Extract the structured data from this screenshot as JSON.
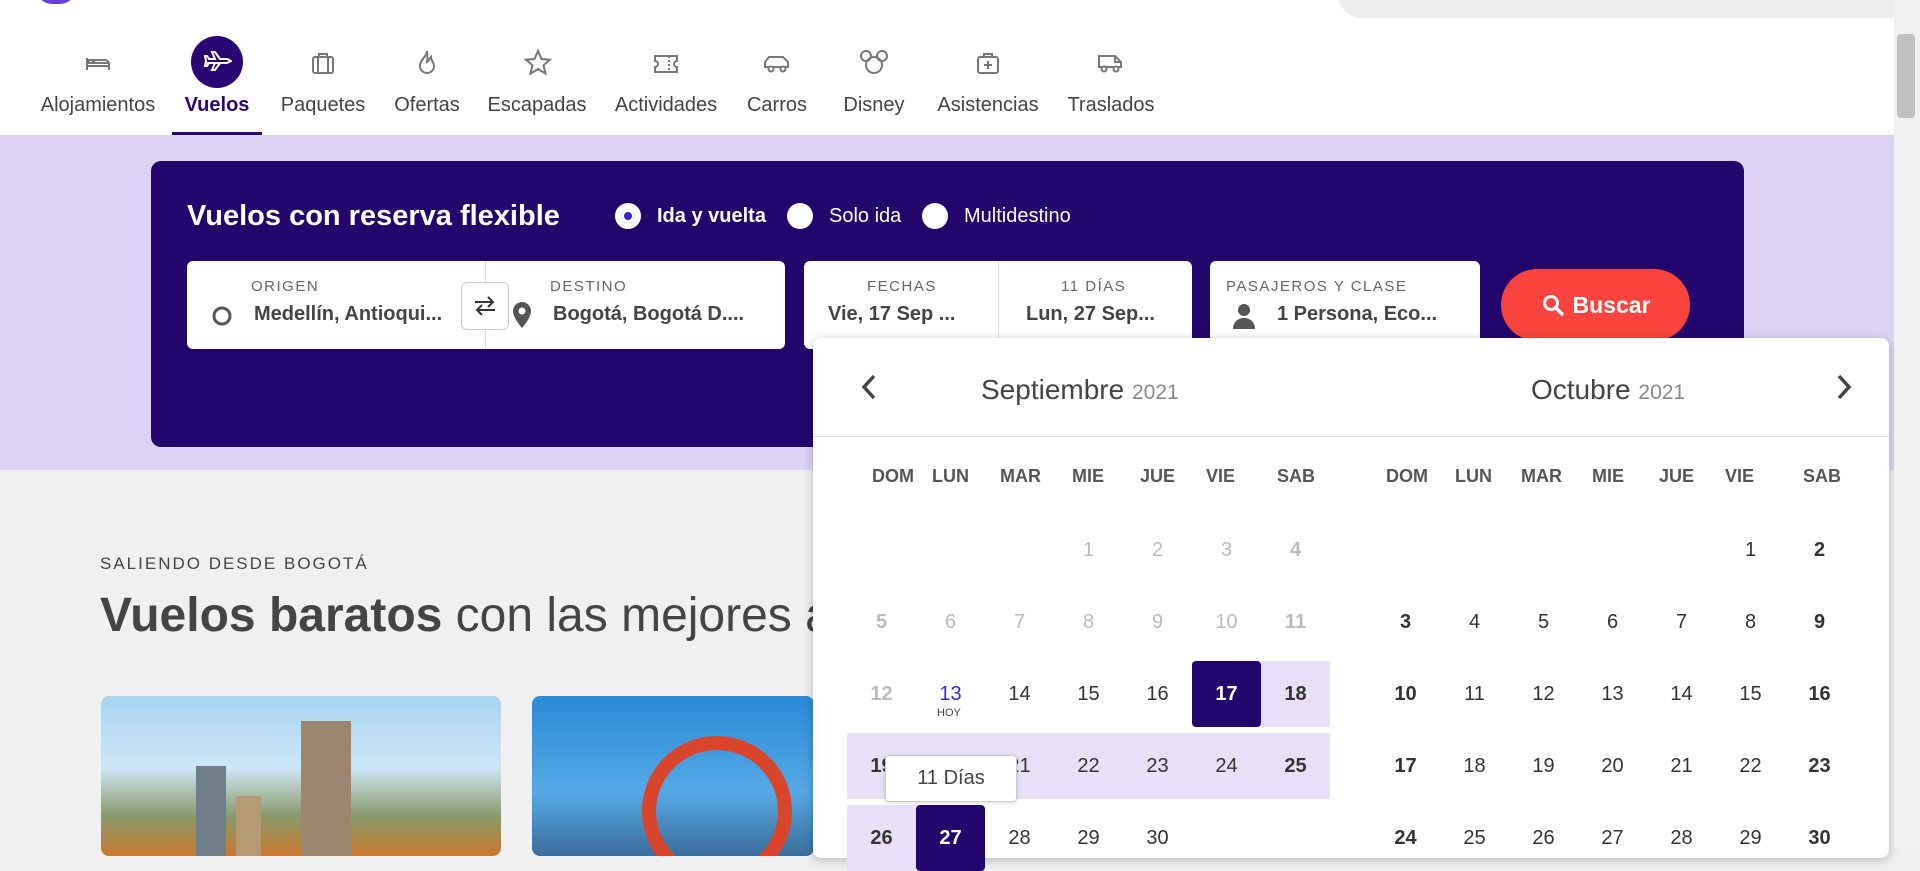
{
  "nav": {
    "items": [
      {
        "label": "Alojamientos",
        "icon": "bed-icon"
      },
      {
        "label": "Vuelos",
        "icon": "plane-icon",
        "active": true
      },
      {
        "label": "Paquetes",
        "icon": "suitcase-icon"
      },
      {
        "label": "Ofertas",
        "icon": "flame-icon"
      },
      {
        "label": "Escapadas",
        "icon": "star-icon"
      },
      {
        "label": "Actividades",
        "icon": "ticket-icon"
      },
      {
        "label": "Carros",
        "icon": "car-icon"
      },
      {
        "label": "Disney",
        "icon": "mickey-icon"
      },
      {
        "label": "Asistencias",
        "icon": "medkit-icon"
      },
      {
        "label": "Traslados",
        "icon": "van-icon"
      }
    ]
  },
  "search": {
    "title": "Vuelos con reserva flexible",
    "trip_types": [
      "Ida y vuelta",
      "Solo ida",
      "Multidestino"
    ],
    "selected_trip_type": "Ida y vuelta",
    "origin_label": "ORIGEN",
    "origin_value": "Medellín, Antioqui...",
    "destination_label": "DESTINO",
    "destination_value": "Bogotá, Bogotá D....",
    "dates_label": "FECHAS",
    "departure_value": "Vie, 17 Sep ...",
    "days_label": "11 DÍAS",
    "return_value": "Lun, 27 Sep...",
    "passengers_label": "PASAJEROS Y CLASE",
    "passengers_value": "1 Persona, Eco...",
    "search_button": "Buscar"
  },
  "content": {
    "section_label": "SALIENDO DESDE BOGOTÁ",
    "title_bold": "Vuelos baratos",
    "title_rest": " con las mejores a"
  },
  "calendar": {
    "months": [
      {
        "name": "Septiembre",
        "year": "2021"
      },
      {
        "name": "Octubre",
        "year": "2021"
      }
    ],
    "weekdays": [
      "DOM",
      "LUN",
      "MAR",
      "MIE",
      "JUE",
      "VIE",
      "SAB"
    ],
    "today_label": "HOY",
    "tooltip": "11 Días",
    "colors": {
      "selected": "#23066b",
      "range": "#e7e0f7",
      "accent": "#f9443f"
    }
  }
}
